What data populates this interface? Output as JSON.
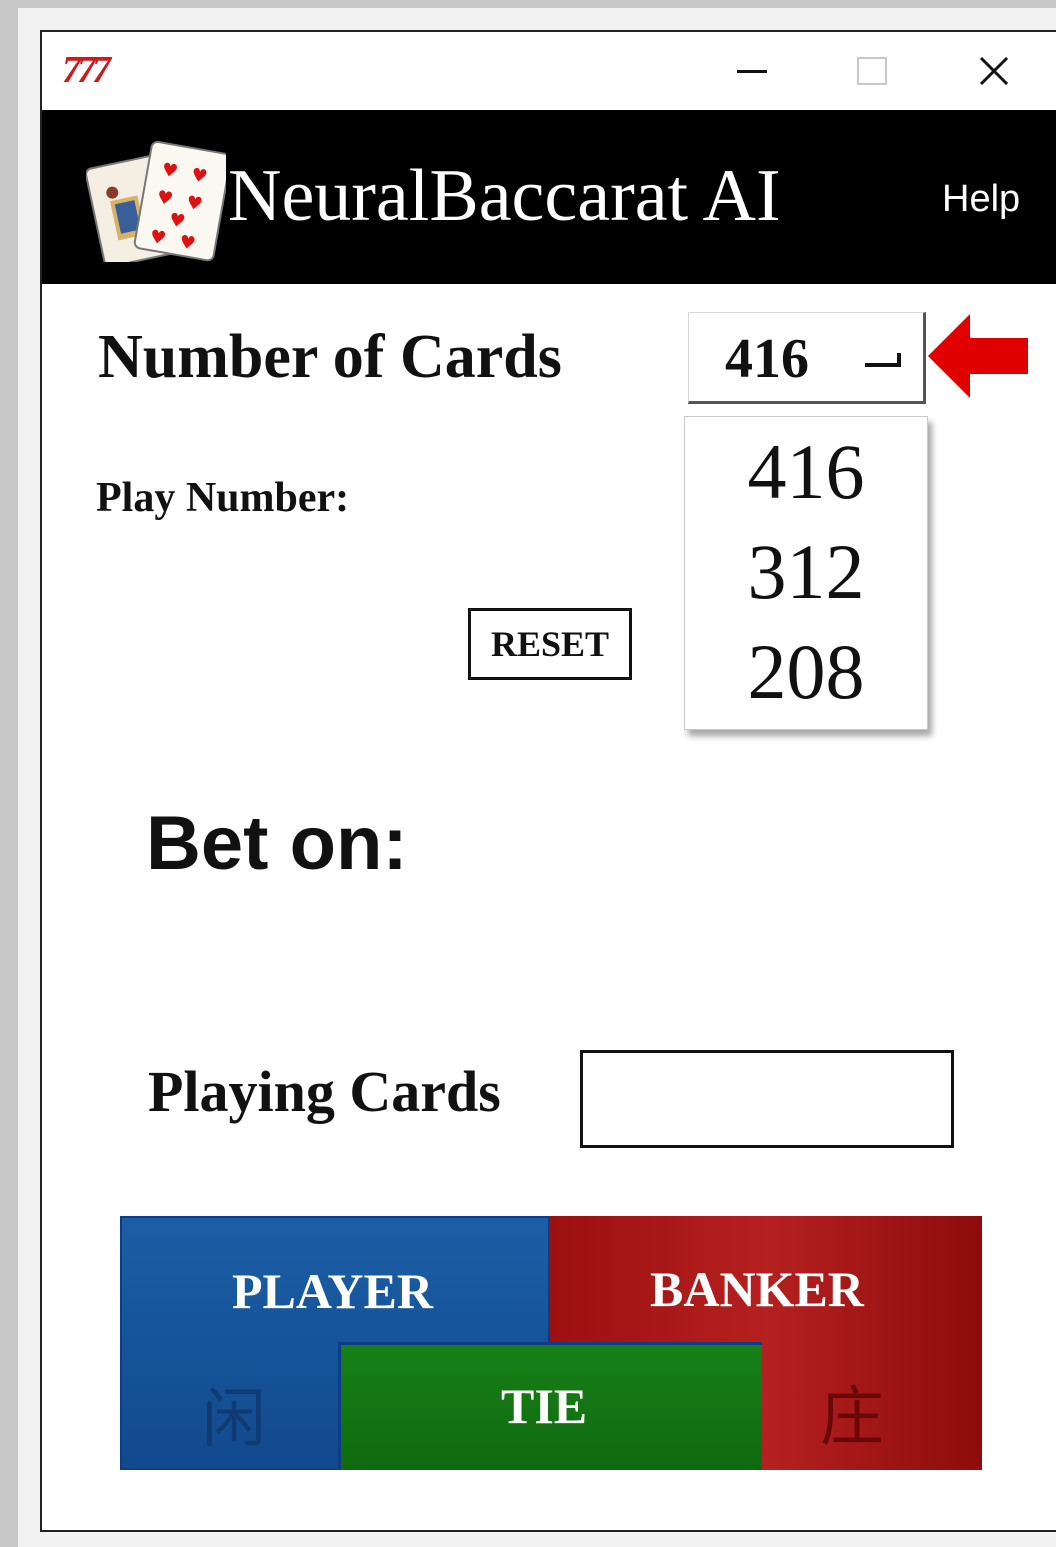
{
  "window": {
    "app_icon_text": "777",
    "controls": {
      "minimize": "minimize",
      "maximize": "maximize",
      "close": "×"
    }
  },
  "header": {
    "title": "NeuralBaccarat AI",
    "help_label": "Help"
  },
  "settings": {
    "number_of_cards_label": "Number of Cards",
    "number_of_cards_selected": "416",
    "number_of_cards_options": [
      "416",
      "312",
      "208"
    ],
    "play_number_label": "Play Number:",
    "reset_label": "RESET"
  },
  "prediction": {
    "bet_on_label": "Bet on:"
  },
  "input": {
    "playing_cards_label": "Playing Cards",
    "playing_cards_value": ""
  },
  "bets": {
    "player_label": "PLAYER",
    "player_cn": "闲",
    "banker_label": "BANKER",
    "banker_cn": "庄",
    "tie_label": "TIE"
  },
  "colors": {
    "player": "#1b5ea6",
    "banker": "#b52020",
    "tie": "#178017",
    "header_bg": "#000000",
    "annotation_arrow": "#e00000"
  }
}
